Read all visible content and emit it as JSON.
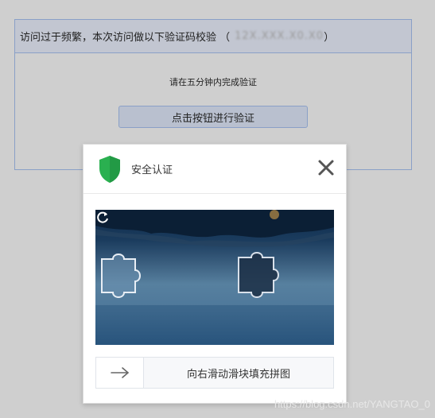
{
  "panel": {
    "header_text": "访问过于频繁，本次访问做以下验证码校验 （",
    "blurred_ip": "12X.XXX.X0.X0",
    "header_close": "）",
    "instruction": "请在五分钟内完成验证",
    "button_label": "点击按钮进行验证"
  },
  "modal": {
    "title": "安全认证",
    "slider_label": "向右滑动滑块填充拼图"
  },
  "watermark": "https://blog.csdn.net/YANGTAO_0",
  "colors": {
    "shield": "#2ab050",
    "accent_border": "#8aa0c7"
  },
  "icons": [
    "shield-icon",
    "close-icon",
    "refresh-icon",
    "arrow-right-icon"
  ]
}
